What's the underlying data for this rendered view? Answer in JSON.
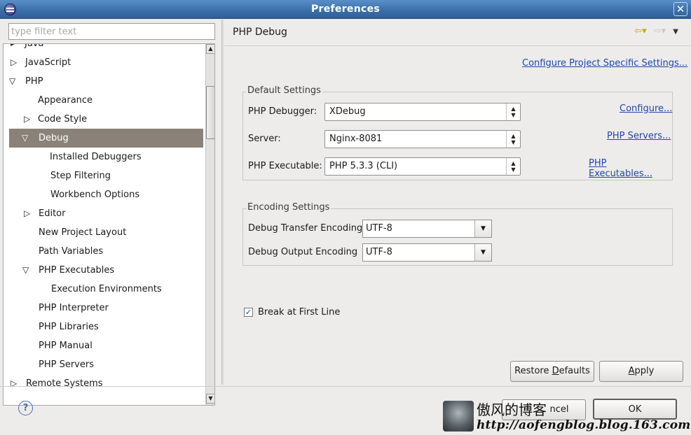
{
  "window": {
    "title": "Preferences"
  },
  "filter": {
    "placeholder": "type filter text"
  },
  "tree": [
    {
      "label": "Java",
      "arrow": "▸"
    },
    {
      "label": "JavaScript",
      "arrow": "▷"
    },
    {
      "label": "PHP",
      "arrow": "▽"
    },
    {
      "label": "Appearance",
      "arrow": ""
    },
    {
      "label": "Code Style",
      "arrow": "▷"
    },
    {
      "label": "Debug",
      "arrow": "▽",
      "selected": true
    },
    {
      "label": "Installed Debuggers",
      "arrow": ""
    },
    {
      "label": "Step Filtering",
      "arrow": ""
    },
    {
      "label": "Workbench Options",
      "arrow": ""
    },
    {
      "label": "Editor",
      "arrow": "▷"
    },
    {
      "label": "New Project Layout",
      "arrow": ""
    },
    {
      "label": "Path Variables",
      "arrow": ""
    },
    {
      "label": "PHP Executables",
      "arrow": "▽"
    },
    {
      "label": "Execution Environments",
      "arrow": ""
    },
    {
      "label": "PHP Interpreter",
      "arrow": ""
    },
    {
      "label": "PHP Libraries",
      "arrow": ""
    },
    {
      "label": "PHP Manual",
      "arrow": ""
    },
    {
      "label": "PHP Servers",
      "arrow": ""
    },
    {
      "label": "Remote Systems",
      "arrow": "▷"
    }
  ],
  "page": {
    "title": "PHP Debug",
    "configure_project_link": "Configure Project Specific Settings...",
    "default_settings": {
      "legend": "Default Settings",
      "debugger_label": "PHP Debugger:",
      "debugger_value": "XDebug",
      "debugger_link": "Configure...",
      "server_label": "Server:",
      "server_value": "Nginx-8081",
      "server_link": "PHP Servers...",
      "exe_label": "PHP Executable:",
      "exe_value": "PHP 5.3.3 (CLI)",
      "exe_link": "PHP Executables..."
    },
    "encoding_settings": {
      "legend": "Encoding Settings",
      "transfer_label": "Debug Transfer Encoding",
      "transfer_value": "UTF-8",
      "output_label": "Debug Output Encoding",
      "output_value": "UTF-8"
    },
    "break_first_line": {
      "label": "Break at First Line",
      "checked": true
    },
    "restore_defaults": {
      "pre": "Restore ",
      "mnemonic": "D",
      "post": "efaults"
    },
    "apply": {
      "mnemonic": "A",
      "post": "pply"
    }
  },
  "footer": {
    "help": "?",
    "cancel_visible": "ncel",
    "ok": "OK"
  },
  "watermark": {
    "title": "傲风的博客",
    "url": "http://aofengblog.blog.163.com"
  }
}
